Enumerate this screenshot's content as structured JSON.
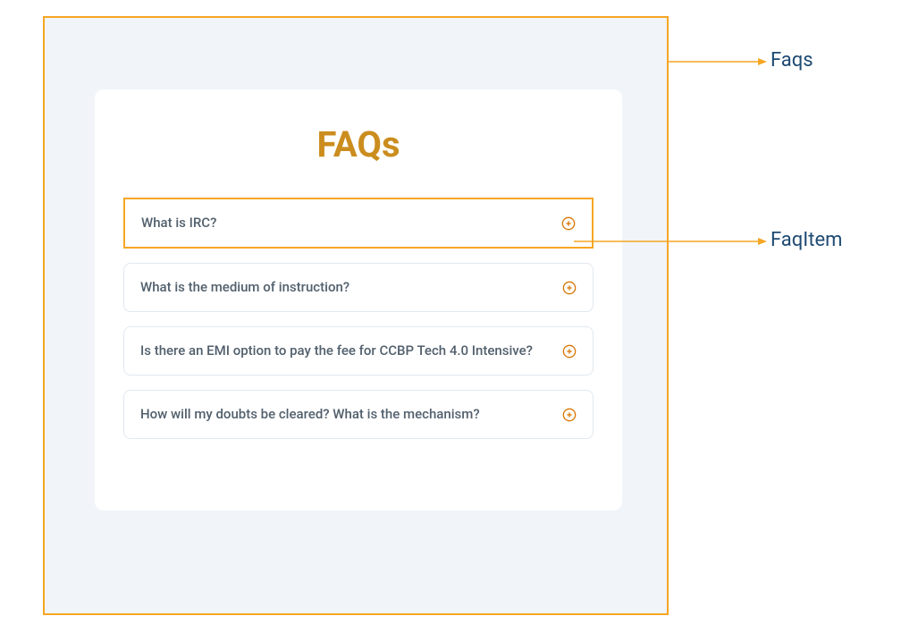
{
  "title": "FAQs",
  "labels": {
    "faqs": "Faqs",
    "faqItem": "FaqItem"
  },
  "faqs": [
    {
      "question": "What is IRC?",
      "highlighted": true
    },
    {
      "question": "What is the medium of instruction?",
      "highlighted": false
    },
    {
      "question": "Is there an EMI option to pay the fee for CCBP Tech 4.0 Intensive?",
      "highlighted": false
    },
    {
      "question": "How will my doubts be cleared? What is the mechanism?",
      "highlighted": false
    }
  ],
  "colors": {
    "accent": "#f5a623",
    "titleColor": "#cb8d1e",
    "labelColor": "#1e4a72",
    "textColor": "#52606d"
  }
}
